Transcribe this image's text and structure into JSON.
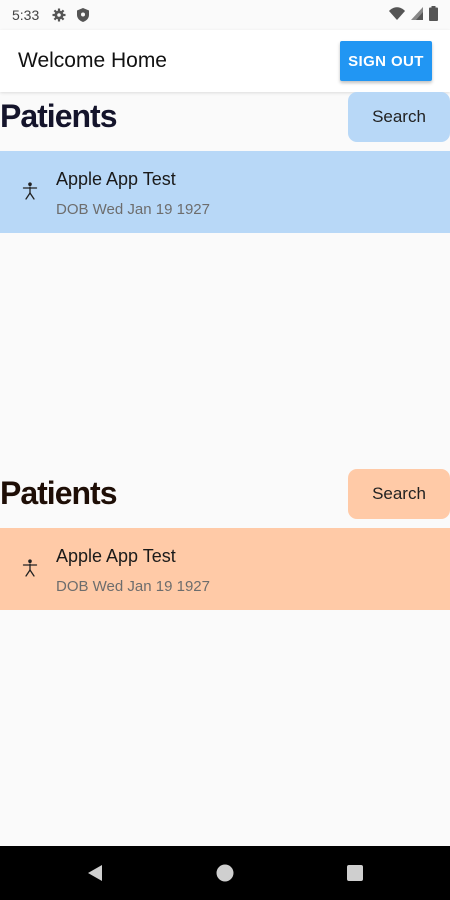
{
  "status_bar": {
    "time": "5:33",
    "icons": [
      "gear-icon",
      "shield-icon",
      "wifi-icon",
      "cell-signal-icon",
      "battery-icon"
    ]
  },
  "app_bar": {
    "title": "Welcome Home",
    "sign_out_label": "SIGN OUT",
    "accent_color": "#2196f3"
  },
  "sections": [
    {
      "title": "Patients",
      "search_label": "Search",
      "color": "#b8d8f7",
      "patients": [
        {
          "name": "Apple App Test",
          "dob": "DOB Wed Jan 19 1927",
          "icon": "person-icon"
        }
      ]
    },
    {
      "title": "Patients",
      "search_label": "Search",
      "color": "#ffcaa7",
      "patients": [
        {
          "name": "Apple App Test",
          "dob": "DOB Wed Jan 19 1927",
          "icon": "person-icon"
        }
      ]
    }
  ],
  "nav_bar": {
    "icons": [
      "back-icon",
      "home-icon",
      "recents-icon"
    ]
  }
}
